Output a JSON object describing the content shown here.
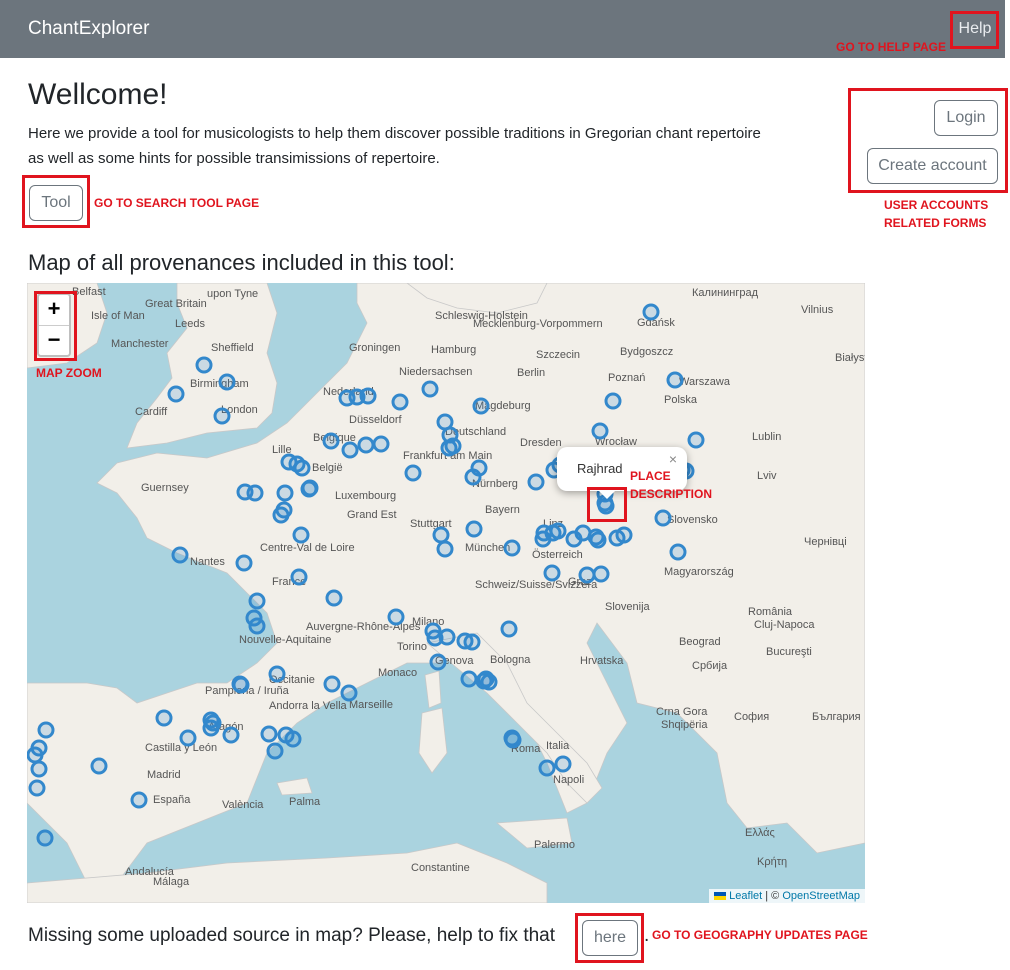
{
  "navbar": {
    "brand": "ChantExplorer",
    "help_label": "Help"
  },
  "main": {
    "heading": "Wellcome!",
    "intro": "Here we provide a tool for musicologists to help them discover possible traditions in Gregorian chant repertoire as well as some hints for possible transimissions of repertoire.",
    "tool_label": "Tool",
    "map_title": "Map of all provenances included in this tool:",
    "missing_text": "Missing some uploaded source in map? Please, help to fix that",
    "here_label": "here",
    "period": "."
  },
  "auth": {
    "login_label": "Login",
    "create_label": "Create account"
  },
  "annotations": {
    "help": "GO TO HELP PAGE",
    "tool": "GO TO SEARCH TOOL PAGE",
    "accounts_line1": "USER ACCOUNTS",
    "accounts_line2": "RELATED FORMS",
    "zoom": "MAP ZOOM",
    "place_line1": "PLACE",
    "place_line2": "DESCRIPTION",
    "geo": "GO TO GEOGRAPHY UPDATES PAGE"
  },
  "map": {
    "zoom_in": "+",
    "zoom_out": "−",
    "popup_text": "Rajhrad",
    "popup_close": "×",
    "attribution_leaflet": "Leaflet",
    "attribution_sep": " | © ",
    "attribution_osm": "OpenStreetMap",
    "colors": {
      "water": "#aad3df",
      "land": "#f2efe9",
      "marker": "#3388cc",
      "annotation": "#e0141e"
    },
    "labels": [
      "Belfast",
      "Great Britain",
      "upon Tyne",
      "Isle of Man",
      "Leeds",
      "Manchester",
      "Sheffield",
      "Birmingham",
      "Cardiff",
      "London",
      "Guernsey",
      "Lille",
      "Belgique",
      "België",
      "Düsseldorf",
      "Frankfurt am Main",
      "Luxembourg",
      "Grand Est",
      "Nederland",
      "Groningen",
      "Niedersachsen",
      "Hamburg",
      "Schleswig-Holstein",
      "Mecklenburg-Vorpommern",
      "Deutschland",
      "Magdeburg",
      "Berlin",
      "Szczecin",
      "Bydgoszcz",
      "Poznań",
      "Gdańsk",
      "Калининград",
      "Vilnius",
      "Białystok",
      "Warszawa",
      "Polska",
      "Wrocław",
      "Lublin",
      "Dresden",
      "Nürnberg",
      "Bayern",
      "Stuttgart",
      "München",
      "Linz",
      "Österreich",
      "Graz",
      "Slovensko",
      "Magyarország",
      "Lviv",
      "Чернівці",
      "Cluj-Napoca",
      "România",
      "Bucureşti",
      "Beograd",
      "Србија",
      "Hrvatska",
      "Slovenija",
      "Schweiz/Suisse/Svizzera",
      "Milano",
      "Torino",
      "Genova",
      "Bologna",
      "Monaco",
      "Marseille",
      "France",
      "Nantes",
      "Centre-Val de Loire",
      "Auvergne-Rhône-Alpes",
      "Nouvelle-Aquitaine",
      "Occitanie",
      "Pamplona / Iruña",
      "Andorra la Vella",
      "Aragón",
      "Castilla y León",
      "Madrid",
      "España",
      "València",
      "Palma",
      "Roma",
      "Italia",
      "Napoli",
      "Palermo",
      "Crna Gora",
      "Shqipëria",
      "София",
      "България",
      "Ελλάς",
      "Κρήτη",
      "Constantine",
      "Málaga",
      "Andalucía"
    ]
  }
}
